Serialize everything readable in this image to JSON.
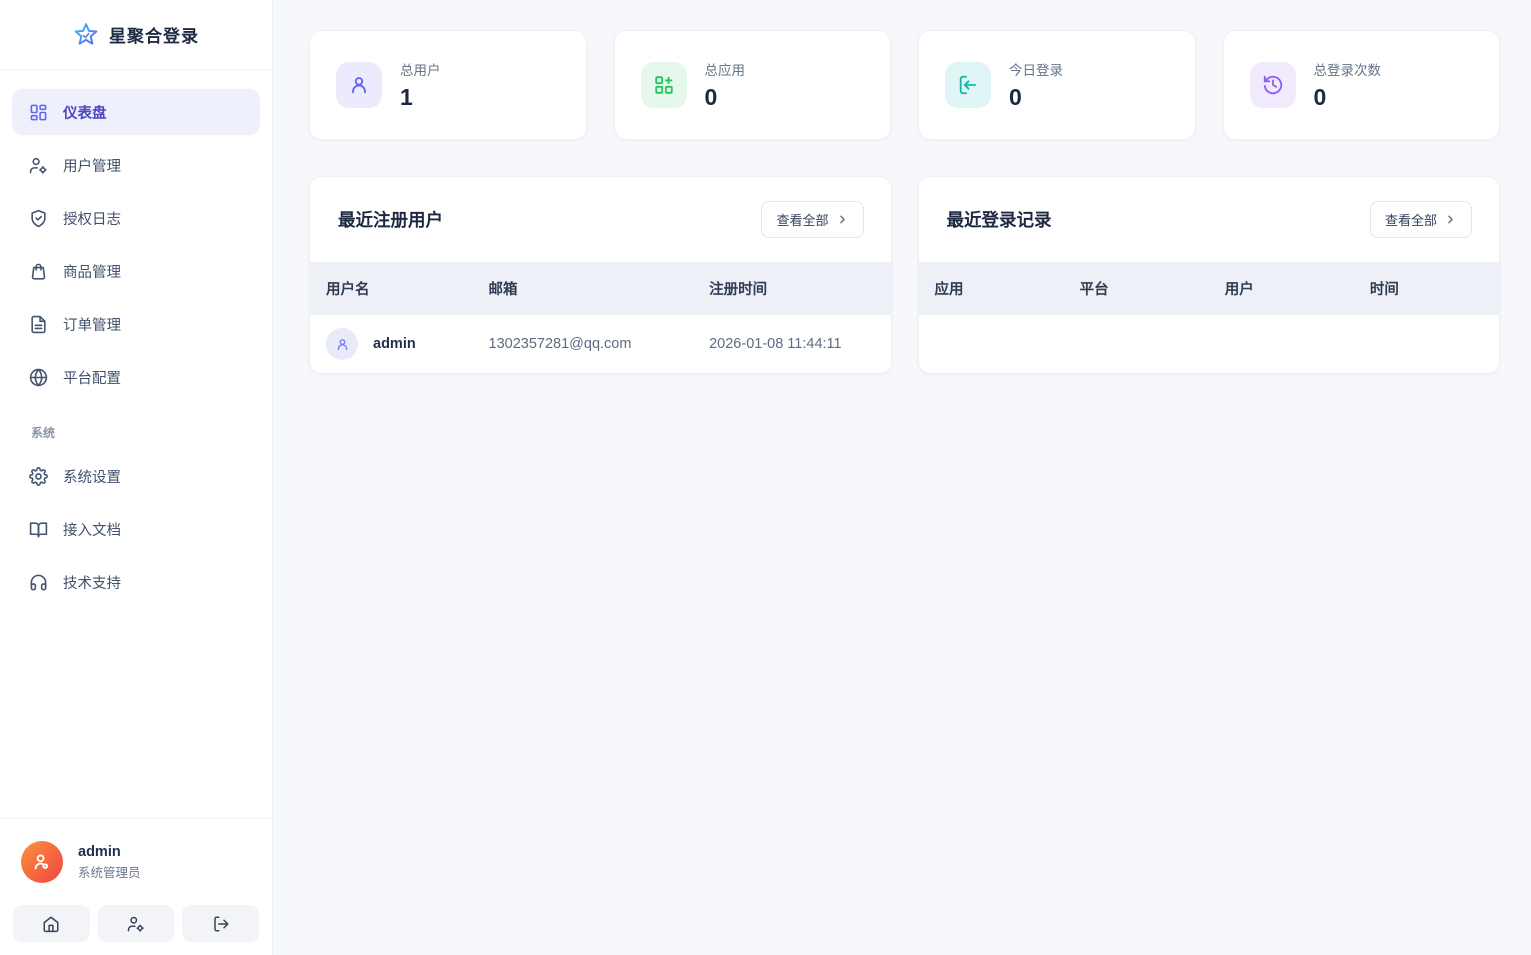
{
  "colors": {
    "accent": "#6366f1",
    "active_item_bg": "#eef0fb",
    "stat_purple": "#6366f1",
    "stat_green": "#22c55e",
    "stat_teal": "#14b8a6",
    "stat_violet": "#8b5cf6",
    "avatar_gradient_start": "#fb923c",
    "avatar_gradient_end": "#ef4444",
    "table_header_bg": "#edf1f7"
  },
  "sidebar": {
    "logo_title": "星聚合登录",
    "logo_icon": "star-icon",
    "items": [
      {
        "label": "仪表盘",
        "icon": "layout-dashboard",
        "active": true
      },
      {
        "label": "用户管理",
        "icon": "user-cog",
        "active": false
      },
      {
        "label": "授权日志",
        "icon": "shield-check",
        "active": false
      },
      {
        "label": "商品管理",
        "icon": "shopping-bag",
        "active": false
      },
      {
        "label": "订单管理",
        "icon": "file-text",
        "active": false
      },
      {
        "label": "平台配置",
        "icon": "globe",
        "active": false
      }
    ],
    "section_label": "系统",
    "system_items": [
      {
        "label": "系统设置",
        "icon": "gear"
      },
      {
        "label": "接入文档",
        "icon": "book-open"
      },
      {
        "label": "技术支持",
        "icon": "headphones"
      }
    ],
    "user": {
      "name": "admin",
      "role": "系统管理员"
    },
    "user_actions": [
      {
        "icon": "home"
      },
      {
        "icon": "user-cog"
      },
      {
        "icon": "logout"
      }
    ]
  },
  "stats": [
    {
      "label": "总用户",
      "value": "1",
      "icon": "user"
    },
    {
      "label": "总应用",
      "value": "0",
      "icon": "grid-plus"
    },
    {
      "label": "今日登录",
      "value": "0",
      "icon": "log-in"
    },
    {
      "label": "总登录次数",
      "value": "0",
      "icon": "history"
    }
  ],
  "panels": {
    "recent_users": {
      "title": "最近注册用户",
      "view_all": "查看全部",
      "columns": [
        "用户名",
        "邮箱",
        "注册时间"
      ],
      "rows": [
        {
          "username": "admin",
          "email": "1302357281@qq.com",
          "time": "2026-01-08 11:44:11"
        }
      ]
    },
    "recent_logins": {
      "title": "最近登录记录",
      "view_all": "查看全部",
      "columns": [
        "应用",
        "平台",
        "用户",
        "时间"
      ],
      "rows": []
    }
  }
}
